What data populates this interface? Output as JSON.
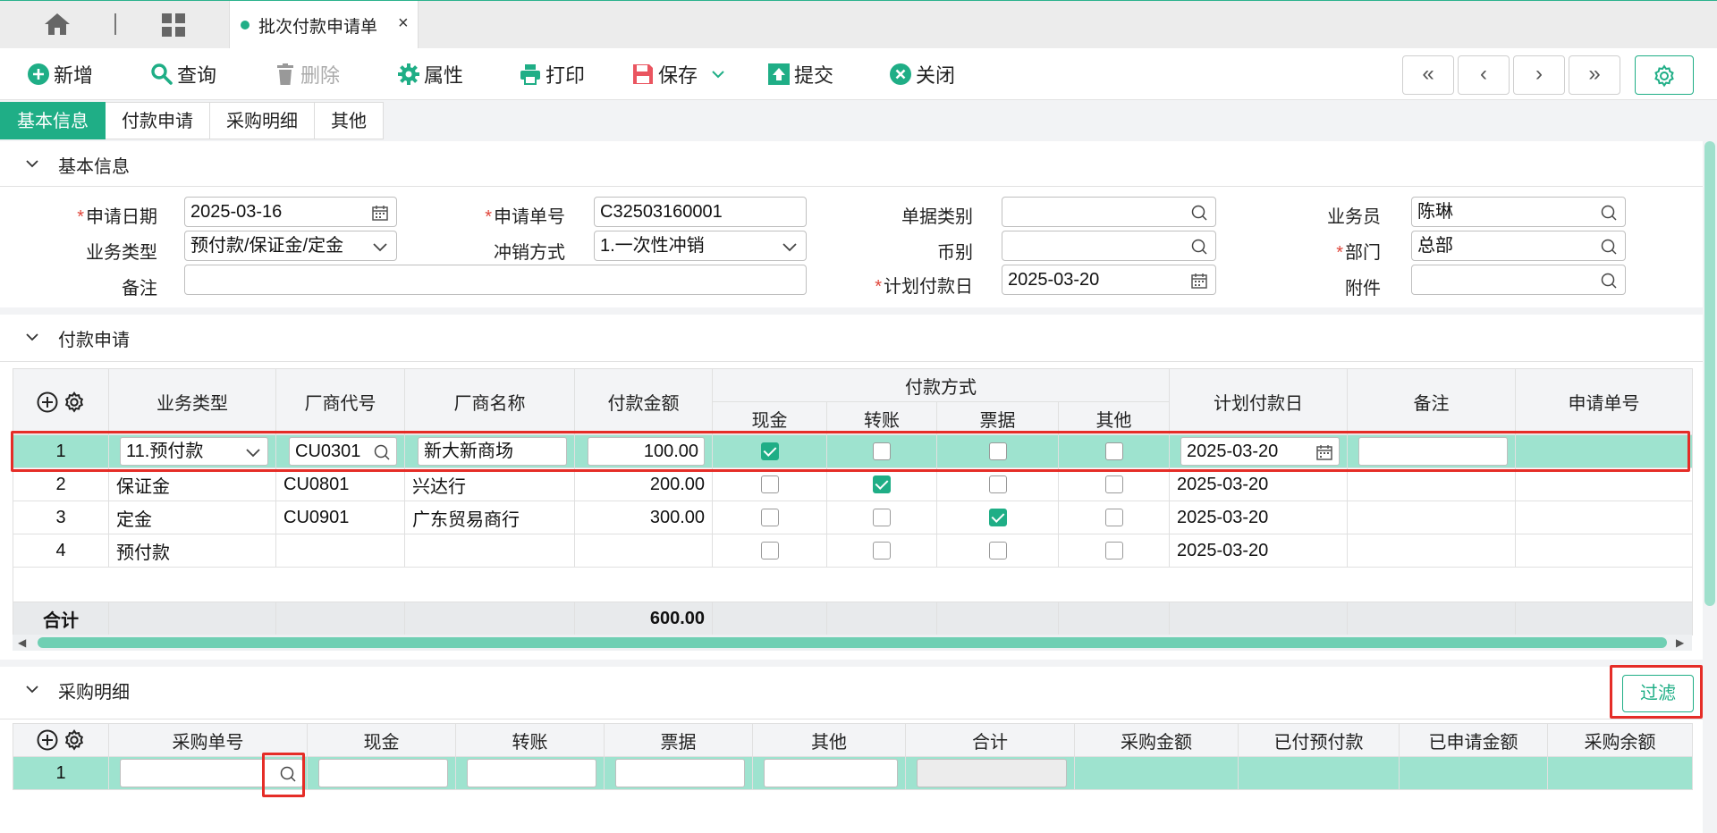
{
  "tabs": {
    "active_title": "批次付款申请单",
    "close": "×"
  },
  "toolbar": {
    "add": "新增",
    "query": "查询",
    "delete": "删除",
    "props": "属性",
    "print": "打印",
    "save": "保存",
    "submit": "提交",
    "close": "关闭",
    "first": "«",
    "prev": "‹",
    "next": "›",
    "last": "»"
  },
  "subtabs": [
    "基本信息",
    "付款申请",
    "采购明细",
    "其他"
  ],
  "basic": {
    "title": "基本信息",
    "apply_date_label": "申请日期",
    "apply_date": "2025-03-16",
    "apply_no_label": "申请单号",
    "apply_no": "C32503160001",
    "doc_type_label": "单据类别",
    "doc_type": "",
    "salesman_label": "业务员",
    "salesman": "陈琳",
    "biz_type_label": "业务类型",
    "biz_type": "预付款/保证金/定金",
    "offset_label": "冲销方式",
    "offset": "1.一次性冲销",
    "currency_label": "币别",
    "currency": "",
    "dept_label": "部门",
    "dept": "总部",
    "remark_label": "备注",
    "remark": "",
    "plan_date_label": "计划付款日",
    "plan_date": "2025-03-20",
    "attach_label": "附件",
    "attach": ""
  },
  "payment": {
    "title": "付款申请",
    "headers": {
      "biz_type": "业务类型",
      "vendor_code": "厂商代号",
      "vendor_name": "厂商名称",
      "amount": "付款金额",
      "pay_method": "付款方式",
      "cash": "现金",
      "transfer": "转账",
      "bill": "票据",
      "other": "其他",
      "plan_date": "计划付款日",
      "remark": "备注",
      "apply_no": "申请单号"
    },
    "rows": [
      {
        "no": "1",
        "biz_type": "11.预付款",
        "vendor_code": "CU0301",
        "vendor_name": "新大新商场",
        "amount": "100.00",
        "plan_date": "2025-03-20",
        "cash": true,
        "transfer": false,
        "bill": false,
        "other": false
      },
      {
        "no": "2",
        "biz_type": "保证金",
        "vendor_code": "CU0801",
        "vendor_name": "兴达行",
        "amount": "200.00",
        "plan_date": "2025-03-20",
        "cash": false,
        "transfer": true,
        "bill": false,
        "other": false
      },
      {
        "no": "3",
        "biz_type": "定金",
        "vendor_code": "CU0901",
        "vendor_name": "广东贸易商行",
        "amount": "300.00",
        "plan_date": "2025-03-20",
        "cash": false,
        "transfer": false,
        "bill": true,
        "other": false
      },
      {
        "no": "4",
        "biz_type": "预付款",
        "vendor_code": "",
        "vendor_name": "",
        "amount": "",
        "plan_date": "2025-03-20",
        "cash": false,
        "transfer": false,
        "bill": false,
        "other": false
      }
    ],
    "total_label": "合计",
    "total": "600.00"
  },
  "purchase": {
    "title": "采购明细",
    "filter": "过滤",
    "headers": {
      "po_no": "采购单号",
      "cash": "现金",
      "transfer": "转账",
      "bill": "票据",
      "other": "其他",
      "sum": "合计",
      "po_amount": "采购金额",
      "prepaid": "已付预付款",
      "applied": "已申请金额",
      "balance": "采购余额"
    },
    "row_no": "1"
  },
  "colors": {
    "accent": "#1fae86",
    "row_selected": "#9ee3cf",
    "required": "#e0463b",
    "highlight": "#e52d27"
  }
}
